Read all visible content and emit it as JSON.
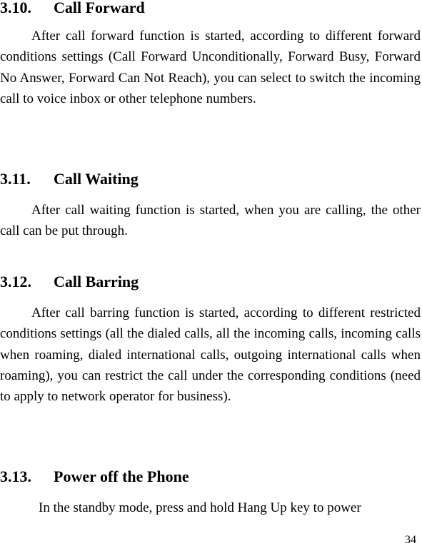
{
  "sections": [
    {
      "number": "3.10.",
      "title": "Call Forward",
      "body": "After call forward function is started, according to different forward conditions settings (Call Forward Unconditionally, Forward Busy, Forward No Answer, Forward Can Not Reach), you can select to switch the incoming call to voice inbox or other telephone numbers."
    },
    {
      "number": "3.11.",
      "title": "Call Waiting",
      "body": "After call waiting function is started, when you are calling, the other call can be put through."
    },
    {
      "number": "3.12.",
      "title": "Call Barring",
      "body": "After call barring function is started, according to different restricted conditions settings (all the dialed calls, all the incoming calls, incoming calls when roaming, dialed international calls, outgoing international calls when roaming), you can restrict the call under the corresponding conditions (need to apply to network operator for business)."
    },
    {
      "number": "3.13.",
      "title": "Power off the Phone",
      "body": "In the standby mode, press and hold Hang Up key to power"
    }
  ],
  "page_number": "34"
}
